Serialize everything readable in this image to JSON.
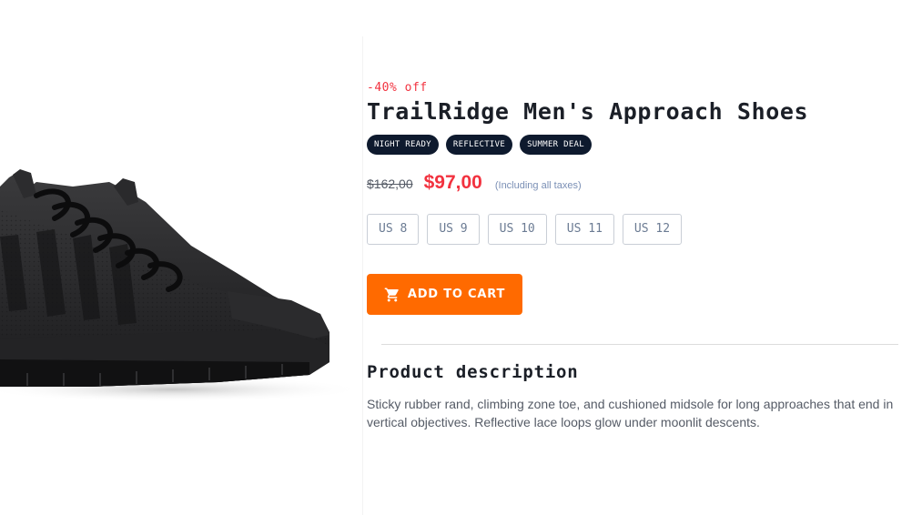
{
  "product": {
    "image_alt": "Black approach shoes",
    "discount": "-40% off",
    "title": "TrailRidge Men's Approach Shoes",
    "tags": [
      "NIGHT READY",
      "REFLECTIVE",
      "SUMMER DEAL"
    ],
    "old_price": "$162,00",
    "price": "$97,00",
    "tax_note": "(Including all taxes)",
    "sizes": [
      "US 8",
      "US 9",
      "US 10",
      "US 11",
      "US 12"
    ],
    "add_to_cart_label": "ADD TO CART",
    "add_to_cart_icon": "cart-icon",
    "description_heading": "Product description",
    "description": "Sticky rubber rand, climbing zone toe, and cushioned midsole for long approaches that end in vertical objectives. Reflective lace loops glow under moonlit descents."
  },
  "colors": {
    "accent": "#ff6a00",
    "sale_red": "#f2323f",
    "tag_bg": "#0e1a2e"
  }
}
